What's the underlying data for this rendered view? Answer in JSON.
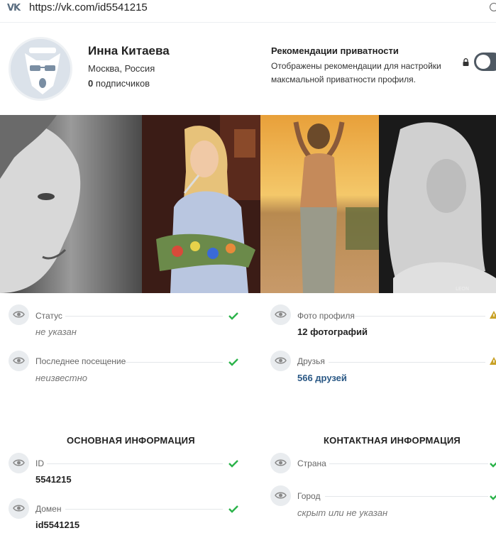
{
  "browser": {
    "url": "https://vk.com/id5541215"
  },
  "profile": {
    "name": "Инна Китаева",
    "city": "Москва, Россия",
    "subscribers_count": "0",
    "subscribers_label": "подписчиков"
  },
  "privacy": {
    "title": "Рекомендации приватности",
    "description": "Отображены рекомендации для настройки максмальной приватности профиля."
  },
  "photos": [
    {
      "name": "photo-bw-portrait"
    },
    {
      "name": "photo-painter"
    },
    {
      "name": "photo-sunset-beach"
    },
    {
      "name": "photo-curly-bw"
    }
  ],
  "info_left": {
    "status": {
      "label": "Статус",
      "value": "не указан"
    },
    "last_seen": {
      "label": "Последнее посещение",
      "value": "неизвестно"
    }
  },
  "info_right": {
    "photos": {
      "label": "Фото профиля",
      "value": "12 фотографий"
    },
    "friends": {
      "label": "Друзья",
      "value": "566 друзей"
    }
  },
  "basic_info": {
    "title": "ОСНОВНАЯ ИНФОРМАЦИЯ",
    "id": {
      "label": "ID",
      "value": "5541215"
    },
    "domain": {
      "label": "Домен",
      "value": "id5541215"
    }
  },
  "contact_info": {
    "title": "КОНТАКТНАЯ ИНФОРМАЦИЯ",
    "country": {
      "label": "Страна"
    },
    "city": {
      "label": "Город",
      "value": "скрыт или не указан"
    }
  },
  "colors": {
    "check": "#2bb34a",
    "warning": "#c9a227",
    "link": "#2a5885",
    "toggle": "#4f5963"
  }
}
